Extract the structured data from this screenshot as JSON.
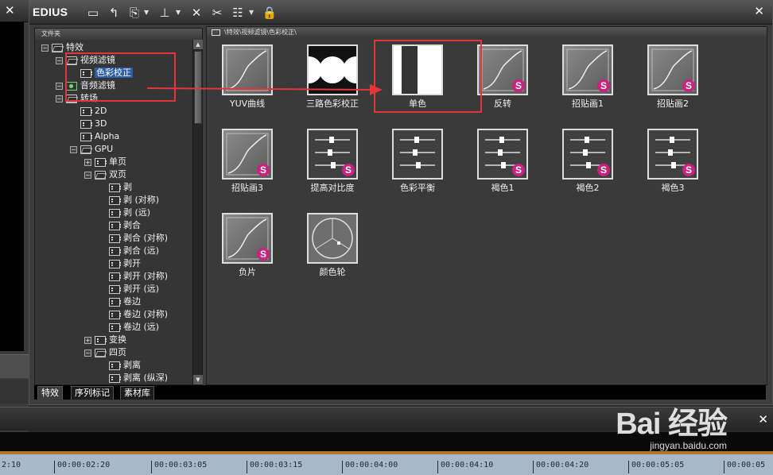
{
  "app": {
    "logo": "EDIUS"
  },
  "toolbar": {
    "icons": [
      "new-folder-icon",
      "up-folder-icon",
      "paste-icon",
      "import-icon",
      "delete-icon",
      "cut-icon",
      "view-icon",
      "lock-icon"
    ]
  },
  "tree": {
    "header": "文件夹",
    "items": [
      {
        "label": "特效",
        "level": 0
      },
      {
        "label": "视频滤镜",
        "level": 1
      },
      {
        "label": "色彩校正",
        "level": 2,
        "selected": true
      },
      {
        "label": "音频滤镜",
        "level": 1
      },
      {
        "label": "转场",
        "level": 1
      },
      {
        "label": "2D",
        "level": 2
      },
      {
        "label": "3D",
        "level": 2
      },
      {
        "label": "Alpha",
        "level": 2
      },
      {
        "label": "GPU",
        "level": 2
      },
      {
        "label": "单页",
        "level": 3
      },
      {
        "label": "双页",
        "level": 3
      },
      {
        "label": "剥",
        "level": 4
      },
      {
        "label": "剥 (对称)",
        "level": 4
      },
      {
        "label": "剥 (远)",
        "level": 4
      },
      {
        "label": "剥合",
        "level": 4
      },
      {
        "label": "剥合 (对称)",
        "level": 4
      },
      {
        "label": "剥合 (远)",
        "level": 4
      },
      {
        "label": "剥开",
        "level": 4
      },
      {
        "label": "剥开 (对称)",
        "level": 4
      },
      {
        "label": "剥开 (远)",
        "level": 4
      },
      {
        "label": "卷边",
        "level": 4
      },
      {
        "label": "卷边 (对称)",
        "level": 4
      },
      {
        "label": "卷边 (远)",
        "level": 4
      },
      {
        "label": "变换",
        "level": 3
      },
      {
        "label": "四页",
        "level": 3
      },
      {
        "label": "剥离",
        "level": 4
      },
      {
        "label": "剥离 (纵深)",
        "level": 4
      }
    ]
  },
  "tabs": [
    "特效",
    "序列标记",
    "素材库"
  ],
  "path": "\\特效\\视频滤镜\\色彩校正\\",
  "effects": [
    {
      "label": "YUV曲线",
      "thumb": "curve",
      "badge": ""
    },
    {
      "label": "三路色彩校正",
      "thumb": "circles",
      "badge": ""
    },
    {
      "label": "单色",
      "thumb": "mono",
      "badge": ""
    },
    {
      "label": "反转",
      "thumb": "curve",
      "badge": "S"
    },
    {
      "label": "招贴画1",
      "thumb": "curve",
      "badge": "S"
    },
    {
      "label": "招贴画2",
      "thumb": "curve",
      "badge": "S"
    },
    {
      "label": "招贴画3",
      "thumb": "curve",
      "badge": "S"
    },
    {
      "label": "提高对比度",
      "thumb": "sliders",
      "badge": "S"
    },
    {
      "label": "色彩平衡",
      "thumb": "sliders",
      "badge": ""
    },
    {
      "label": "褐色1",
      "thumb": "sliders",
      "badge": "S"
    },
    {
      "label": "褐色2",
      "thumb": "sliders",
      "badge": "S"
    },
    {
      "label": "褐色3",
      "thumb": "sliders",
      "badge": "S"
    },
    {
      "label": "负片",
      "thumb": "curve",
      "badge": "S"
    },
    {
      "label": "颜色轮",
      "thumb": "wheel",
      "badge": ""
    }
  ],
  "timeline": {
    "timecodes": [
      "2:10",
      "00:00:02:20",
      "00:00:03:05",
      "00:00:03:15",
      "00:00:04:00",
      "00:00:04:10",
      "00:00:04:20",
      "00:00:05:05",
      "00:00:05"
    ]
  },
  "watermark": {
    "text": "Bai 经验",
    "url": "jingyan.baidu.com"
  },
  "colors": {
    "accent_red": "#e4363a",
    "selected_blue": "#2c5ea8",
    "badge_magenta": "#c8237f"
  }
}
